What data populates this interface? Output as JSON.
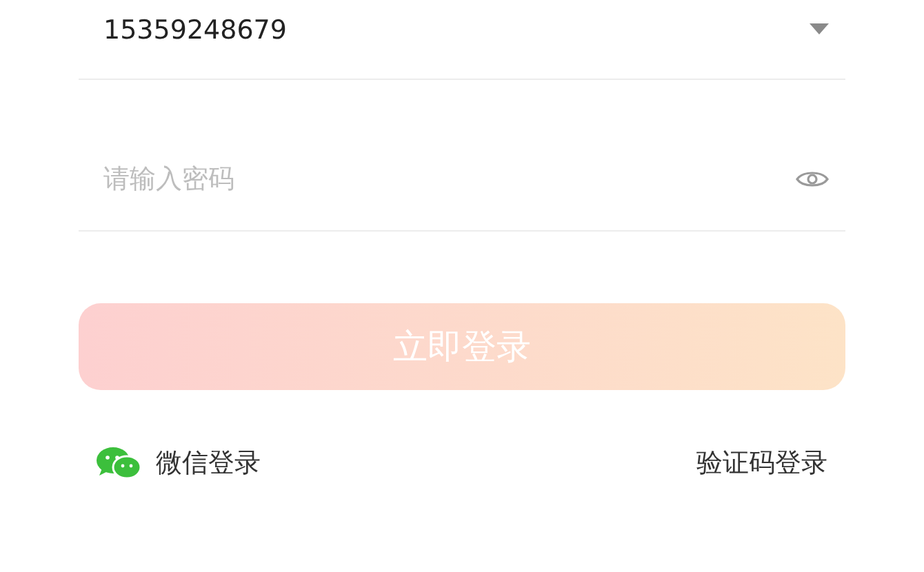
{
  "phone_field": {
    "value": "15359248679"
  },
  "password_field": {
    "placeholder": "请输入密码"
  },
  "login_button": {
    "label": "立即登录",
    "disabled": true
  },
  "wechat_login": {
    "label": "微信登录"
  },
  "code_login": {
    "label": "验证码登录"
  }
}
